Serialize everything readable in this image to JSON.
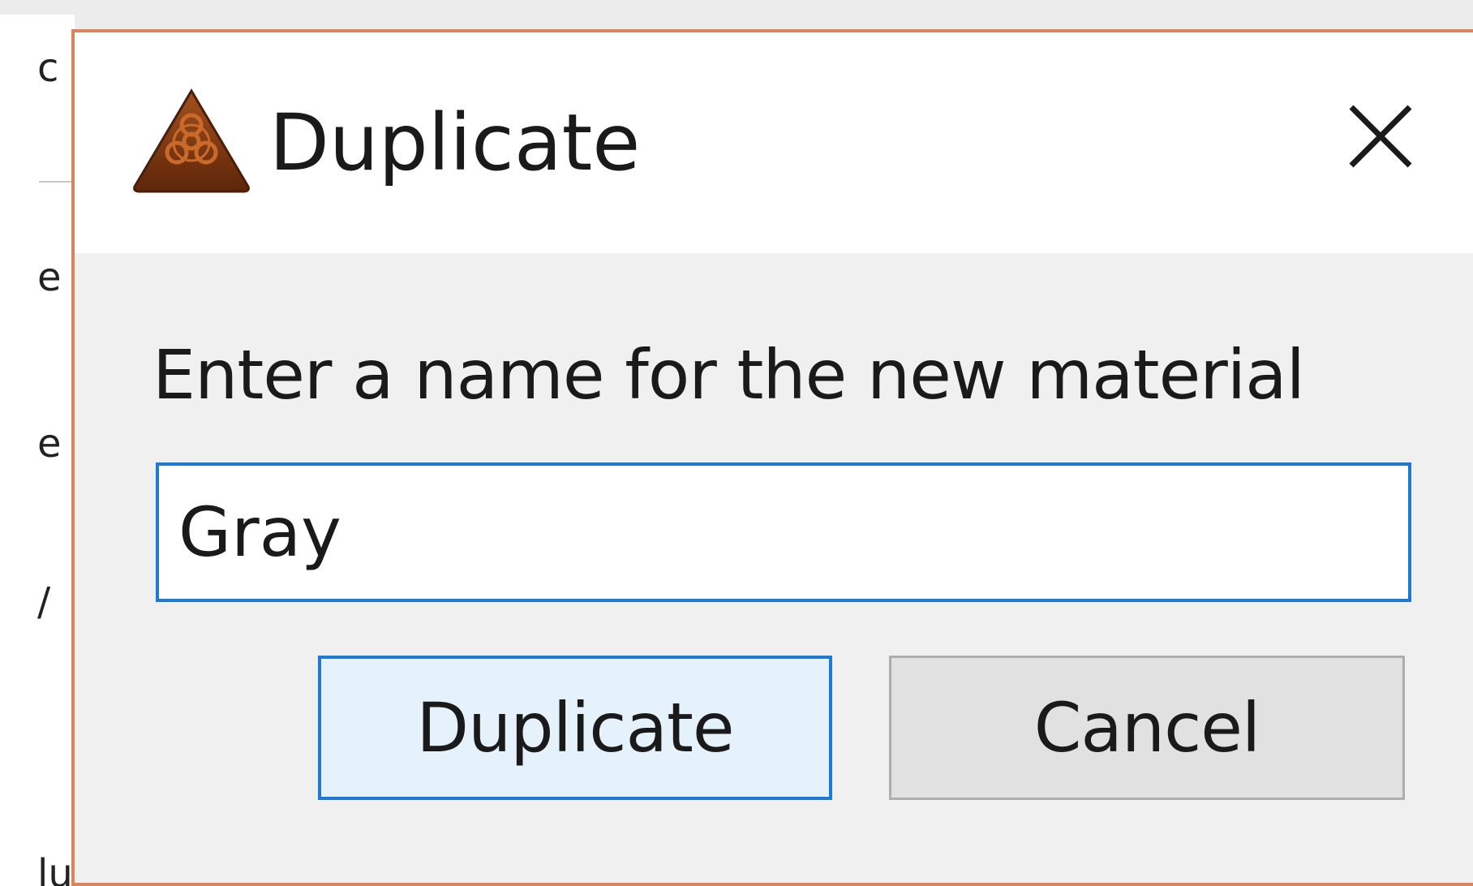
{
  "background_app": {
    "fragments": [
      "c",
      "e",
      "e",
      "/",
      "lu"
    ]
  },
  "dialog": {
    "title": "Duplicate",
    "title_icon": "biohazard-warning-icon",
    "close_icon": "close-icon",
    "prompt": "Enter a name for the new material",
    "name_input": {
      "value": "Gray",
      "placeholder": ""
    },
    "buttons": {
      "duplicate_label": "Duplicate",
      "cancel_label": "Cancel"
    }
  },
  "colors": {
    "focus_border": "#1c7ad4",
    "primary_button_bg": "#e5f1fb",
    "secondary_button_bg": "#e1e1e1",
    "dialog_border": "#d9845a",
    "icon_fill": "#8a3a12"
  }
}
